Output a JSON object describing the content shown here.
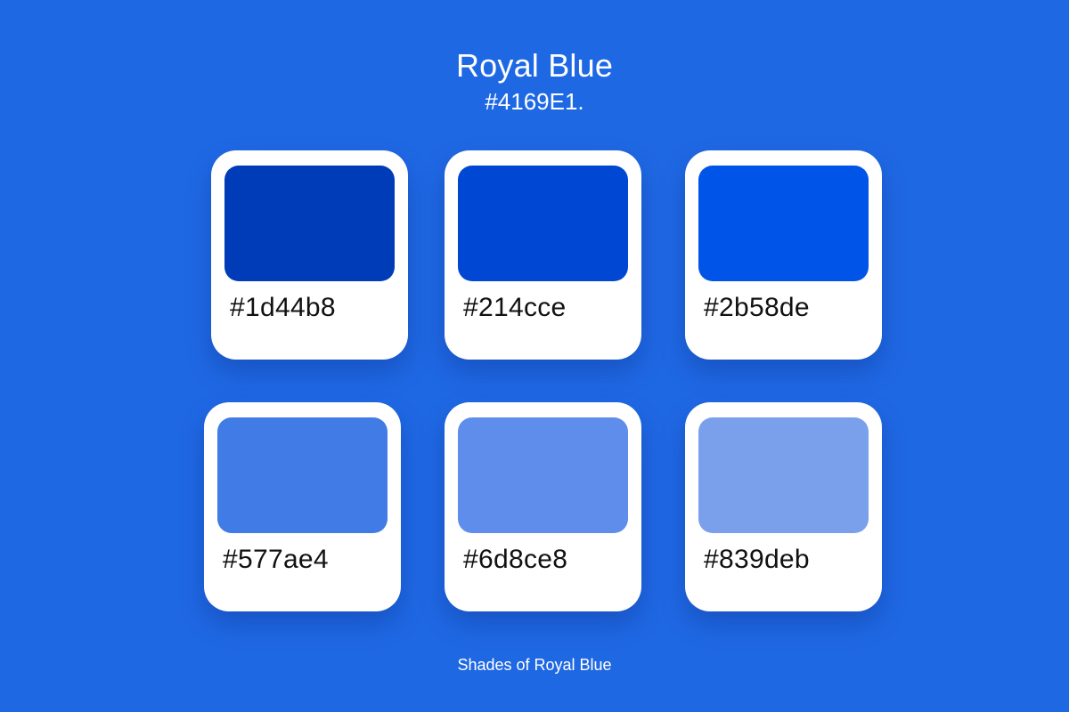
{
  "header": {
    "title": "Royal Blue",
    "subtitle": "#4169E1."
  },
  "swatches": [
    {
      "label": "#1d44b8",
      "color": "#003cb8"
    },
    {
      "label": "#214cce",
      "color": "#0048d4"
    },
    {
      "label": "#2b58de",
      "color": "#0055e8"
    },
    {
      "label": "#577ae4",
      "color": "#417ce6"
    },
    {
      "label": "#6d8ce8",
      "color": "#5e8deb"
    },
    {
      "label": "#839deb",
      "color": "#7aa0ec"
    }
  ],
  "footer": {
    "text": "Shades of Royal Blue"
  },
  "colors": {
    "background": "#1f68e4",
    "card": "#ffffff",
    "title_text": "#ffffff",
    "hex_text": "#111111"
  }
}
